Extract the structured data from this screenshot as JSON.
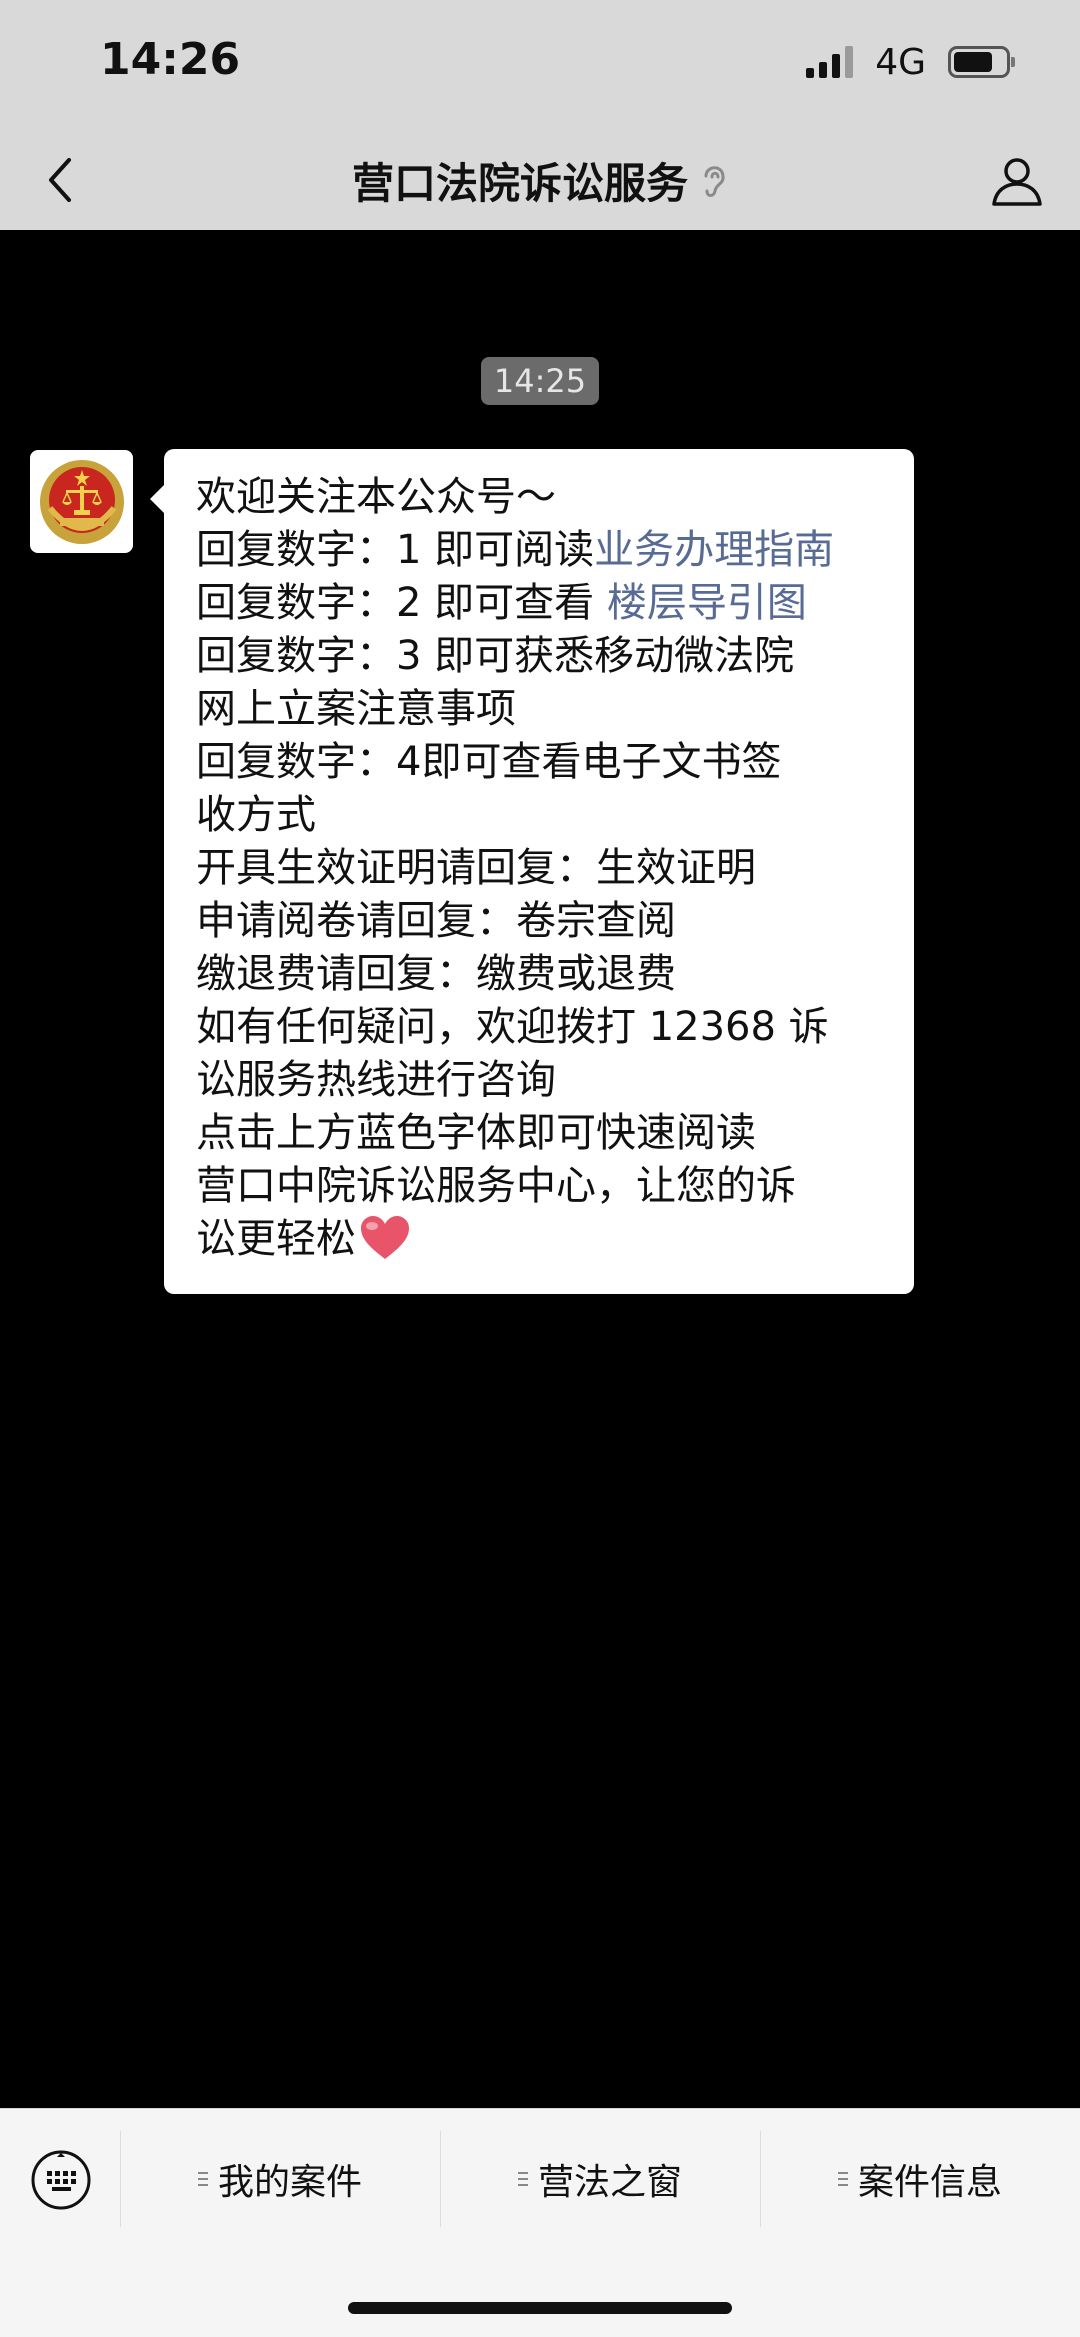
{
  "status": {
    "time": "14:26",
    "network": "4G"
  },
  "nav": {
    "title": "营口法院诉讼服务"
  },
  "chat": {
    "timestamp": "14:25",
    "message": {
      "lines": [
        {
          "segments": [
            {
              "text": "欢迎关注本公众号～"
            }
          ]
        },
        {
          "segments": [
            {
              "text": "回复数字：1 即可阅读"
            },
            {
              "text": "业务办理指南",
              "link": true
            }
          ]
        },
        {
          "segments": [
            {
              "text": "回复数字：2 即可查看 "
            },
            {
              "text": "楼层导引图",
              "link": true
            }
          ]
        },
        {
          "segments": [
            {
              "text": "回复数字：3 即可获悉移动微法院"
            }
          ]
        },
        {
          "segments": [
            {
              "text": "网上立案注意事项"
            }
          ]
        },
        {
          "segments": [
            {
              "text": "回复数字：4即可查看电子文书签"
            }
          ]
        },
        {
          "segments": [
            {
              "text": "收方式"
            }
          ]
        },
        {
          "segments": [
            {
              "text": "开具生效证明请回复：生效证明"
            }
          ]
        },
        {
          "segments": [
            {
              "text": "申请阅卷请回复：卷宗查阅"
            }
          ]
        },
        {
          "segments": [
            {
              "text": "缴退费请回复：缴费或退费"
            }
          ]
        },
        {
          "segments": [
            {
              "text": "如有任何疑问，欢迎拨打 12368 诉"
            }
          ]
        },
        {
          "segments": [
            {
              "text": "讼服务热线进行咨询"
            }
          ]
        },
        {
          "segments": [
            {
              "text": "点击上方蓝色字体即可快速阅读"
            }
          ]
        },
        {
          "segments": [
            {
              "text": "营口中院诉讼服务中心，让您的诉"
            }
          ]
        },
        {
          "segments": [
            {
              "text": "讼更轻松"
            }
          ],
          "emoji": "heart-icon"
        }
      ]
    }
  },
  "menu": {
    "items": [
      {
        "label": "我的案件"
      },
      {
        "label": "营法之窗"
      },
      {
        "label": "案件信息"
      }
    ]
  },
  "colors": {
    "link": "#576b95",
    "heart": "#e8546a"
  }
}
